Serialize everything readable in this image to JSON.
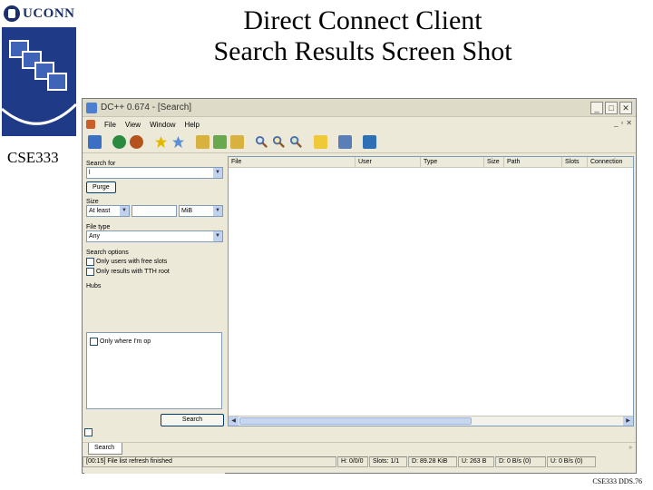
{
  "slide": {
    "title_line1": "Direct Connect Client",
    "title_line2": "Search Results Screen Shot",
    "logo_text": "UCONN",
    "course": "CSE333",
    "footer": "CSE333 DDS.76"
  },
  "window": {
    "title": "DC++ 0.674 - [Search]",
    "controls": [
      "_",
      "□",
      "✕"
    ],
    "mdi_controls": [
      "_",
      "▫",
      "✕"
    ]
  },
  "menu": [
    "File",
    "View",
    "Window",
    "Help"
  ],
  "toolbar_icons": [
    "public-hubs-icon",
    "reconnect-icon",
    "follow-redirect-icon",
    "favorite-hubs-icon",
    "favorite-users-icon",
    "download-queue-icon",
    "finished-downloads-icon",
    "upload-queue-icon",
    "search-icon",
    "adl-search-icon",
    "search-spy-icon",
    "open-file-list-icon",
    "settings-icon",
    "notepad-icon"
  ],
  "search_panel": {
    "search_for_label": "Search for",
    "search_for_value": "l",
    "purge_label": "Purge",
    "size_label": "Size",
    "size_mode": "At least",
    "size_value": "",
    "size_unit": "MiB",
    "file_type_label": "File type",
    "file_type_value": "Any",
    "options_label": "Search options",
    "opt_free_slots": "Only users with free slots",
    "opt_tth": "Only results with TTH root",
    "hubs_label": "Hubs",
    "hubs_item": "Only where I'm op",
    "search_button": "Search"
  },
  "results": {
    "columns": [
      "File",
      "User",
      "Type",
      "Size",
      "Path",
      "Slots",
      "Connection"
    ]
  },
  "tabs": [
    "Search"
  ],
  "status": {
    "message": "[00:15] File list refresh finished",
    "hubs": "H: 0/0/0",
    "slots": "Slots: 1/1",
    "downloaded": "D: 89.28 KiB",
    "uploaded": "U: 263 B",
    "down_rate": "D: 0 B/s (0)",
    "up_rate": "U: 0 B/s (0)"
  },
  "colors": {
    "dept_blue": "#1f3b87",
    "uconn_navy": "#1b2f6b",
    "window_face": "#ece9d8"
  }
}
